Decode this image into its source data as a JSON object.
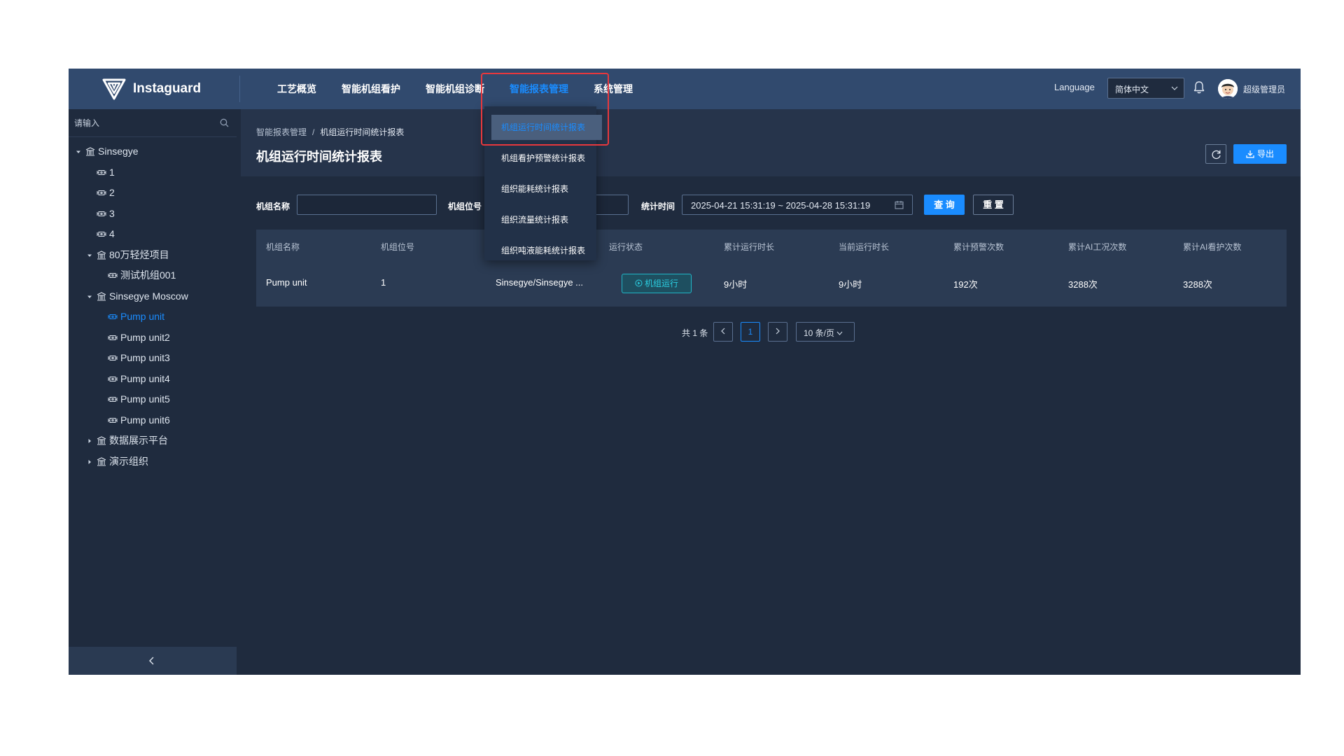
{
  "header": {
    "app_name": "Instaguard",
    "nav": [
      {
        "label": "工艺概览"
      },
      {
        "label": "智能机组看护"
      },
      {
        "label": "智能机组诊断"
      },
      {
        "label": "智能报表管理",
        "active": true
      },
      {
        "label": "系统管理"
      }
    ],
    "language_label": "Language",
    "language_value": "简体中文",
    "user_name": "超级管理员"
  },
  "nav_dropdown": {
    "items": [
      {
        "label": "机组运行时间统计报表",
        "hovered": true
      },
      {
        "label": "机组看护预警统计报表"
      },
      {
        "label": "组织能耗统计报表"
      },
      {
        "label": "组织流量统计报表"
      },
      {
        "label": "组织吨液能耗统计报表"
      }
    ]
  },
  "sidebar": {
    "search_placeholder": "请输入",
    "tree": [
      {
        "label": "Sinsegye",
        "level": 0,
        "type": "org",
        "expanded": true
      },
      {
        "label": "1",
        "level": 1,
        "type": "unit"
      },
      {
        "label": "2",
        "level": 1,
        "type": "unit"
      },
      {
        "label": "3",
        "level": 1,
        "type": "unit"
      },
      {
        "label": "4",
        "level": 1,
        "type": "unit"
      },
      {
        "label": "80万轻烃项目",
        "level": 1,
        "type": "org",
        "expanded": true
      },
      {
        "label": "测试机组001",
        "level": 2,
        "type": "unit"
      },
      {
        "label": "Sinsegye Moscow",
        "level": 1,
        "type": "org",
        "expanded": true
      },
      {
        "label": "Pump unit",
        "level": 2,
        "type": "unit",
        "selected": true
      },
      {
        "label": "Pump unit2",
        "level": 2,
        "type": "unit"
      },
      {
        "label": "Pump unit3",
        "level": 2,
        "type": "unit"
      },
      {
        "label": "Pump unit4",
        "level": 2,
        "type": "unit"
      },
      {
        "label": "Pump unit5",
        "level": 2,
        "type": "unit"
      },
      {
        "label": "Pump unit6",
        "level": 2,
        "type": "unit"
      },
      {
        "label": "数据展示平台",
        "level": 1,
        "type": "org",
        "expanded": false
      },
      {
        "label": "演示组织",
        "level": 1,
        "type": "org",
        "expanded": false
      }
    ]
  },
  "page": {
    "breadcrumb_parent": "智能报表管理",
    "breadcrumb_sep": "/",
    "breadcrumb_current": "机组运行时间统计报表",
    "title": "机组运行时间统计报表",
    "export_label": "导出"
  },
  "filters": {
    "unit_name_label": "机组名称",
    "unit_name_value": "",
    "unit_tag_label": "机组位号",
    "unit_tag_value": "",
    "time_label": "统计时间",
    "time_range": "2025-04-21 15:31:19  ~  2025-04-28 15:31:19",
    "query_label": "查 询",
    "reset_label": "重 置"
  },
  "table": {
    "columns": [
      "机组名称",
      "机组位号",
      "",
      "运行状态",
      "累计运行时长",
      "当前运行时长",
      "累计预警次数",
      "累计AI工况次数",
      "累计AI看护次数"
    ],
    "rows": [
      {
        "name": "Pump unit",
        "tag": "1",
        "org": "Sinsegye/Sinsegye ...",
        "status": "机组运行",
        "total_runtime": "9小时",
        "current_runtime": "9小时",
        "warnings": "192次",
        "ai_conditions": "3288次",
        "ai_care": "3288次"
      }
    ]
  },
  "pagination": {
    "total_text": "共 1 条",
    "current_page": "1",
    "page_size": "10 条/页"
  },
  "colors": {
    "accent": "#1a8cff",
    "header_bg": "#314a6e",
    "app_bg": "#1f2b3e",
    "status": "#2bd0e3",
    "highlight": "#e8383d"
  }
}
